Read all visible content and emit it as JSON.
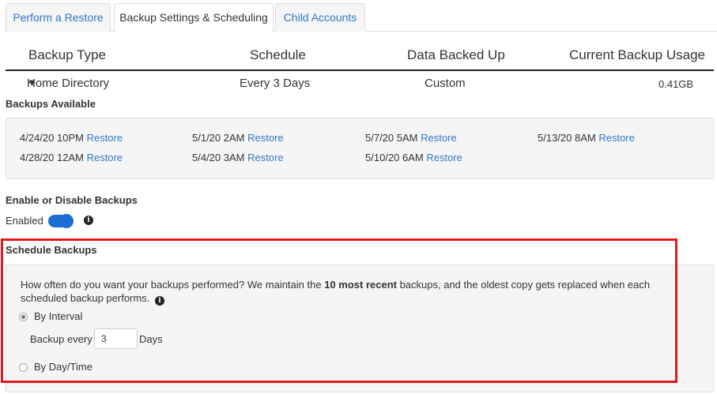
{
  "tabs": [
    {
      "label": "Perform a Restore",
      "active": false
    },
    {
      "label": "Backup Settings & Scheduling",
      "active": true
    },
    {
      "label": "Child Accounts",
      "active": false
    }
  ],
  "table": {
    "headers": [
      "Backup Type",
      "Schedule",
      "Data Backed Up",
      "Current Backup Usage"
    ],
    "row": {
      "expand_icon": "▼",
      "type": "Home Directory",
      "schedule": "Every 3 Days",
      "data": "Custom",
      "usage": "0.41GB"
    }
  },
  "backups_available": {
    "label": "Backups Available",
    "restore_label": "Restore",
    "points": [
      "4/24/20 10PM",
      "4/28/20 12AM",
      "5/1/20 2AM",
      "5/4/20 3AM",
      "5/7/20 5AM",
      "5/10/20 6AM",
      "5/13/20 8AM"
    ]
  },
  "enable": {
    "label": "Enable or Disable Backups",
    "status": "Enabled",
    "toggle_on": true,
    "info_glyph": "i"
  },
  "schedule": {
    "label": "Schedule Backups",
    "desc_before": "How often do you want your backups performed? We maintain the ",
    "desc_bold": "10 most recent",
    "desc_after": " backups, and the oldest copy gets replaced when each scheduled backup performs.",
    "interval_label": "By Interval",
    "interval_selected": true,
    "backup_every_label": "Backup every",
    "interval_value": "3",
    "days_label": "Days",
    "daytime_label": "By Day/Time"
  },
  "colors": {
    "link": "#3079c5",
    "toggle": "#1a6fd0",
    "highlight": "#e3171c"
  }
}
